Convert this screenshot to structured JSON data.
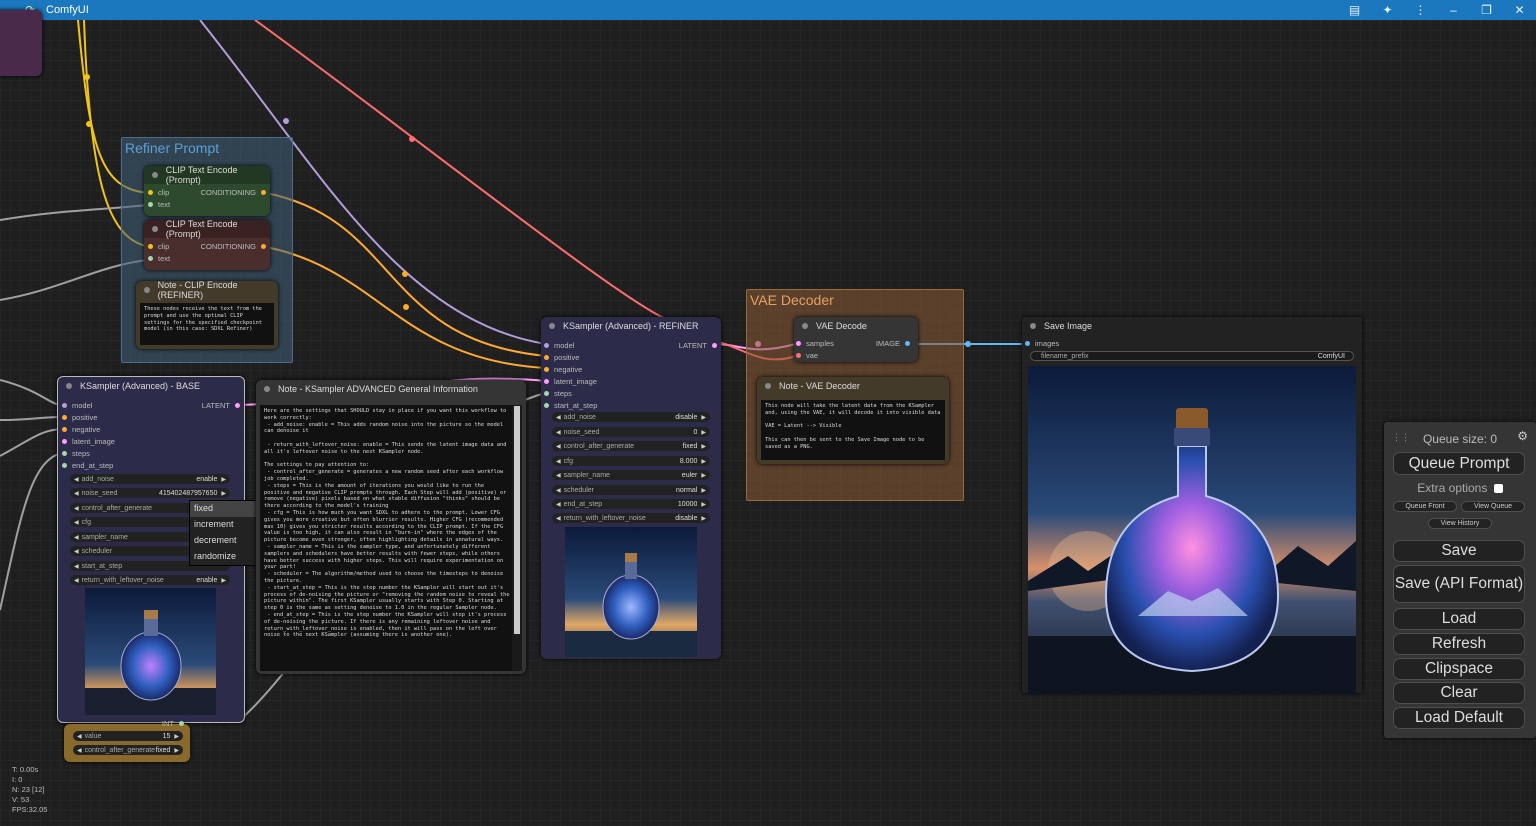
{
  "window": {
    "title": "ComfyUI"
  },
  "colors": {
    "titlebar": "#1c78be",
    "canvas": "#1f1f1f",
    "node_bg": "#353535",
    "green_node": "#2e4a2e",
    "brown_node": "#4a2e2e",
    "vae_group": "#8a5a34",
    "refiner_group": "#3f5f78",
    "clip_wire": "#f0c419",
    "model_wire": "#b39ddb",
    "conditioning_wire": "#ffa931",
    "latent_wire": "#ff9cf9",
    "image_wire": "#64b5f6",
    "vae_wire": "#ff6e6e"
  },
  "groups": {
    "refiner_prompt": {
      "title": "Refiner Prompt"
    },
    "vae_decoder": {
      "title": "VAE Decoder"
    }
  },
  "clip_pos": {
    "title": "CLIP Text Encode (Prompt)",
    "in_clip": "clip",
    "in_text": "text",
    "out": "CONDITIONING"
  },
  "clip_neg": {
    "title": "CLIP Text Encode (Prompt)",
    "in_clip": "clip",
    "in_text": "text",
    "out": "CONDITIONING"
  },
  "note_clip": {
    "title": "Note - CLIP Encode (REFINER)",
    "text": "These nodes receive the text from the prompt and use the optimal CLIP settings for the specified checkpoint model (in this case: SDXL Refiner)"
  },
  "ksampler_base": {
    "title": "KSampler (Advanced) - BASE",
    "inputs": [
      "model",
      "positive",
      "negative",
      "latent_image",
      "steps",
      "end_at_step"
    ],
    "output": "LATENT",
    "widgets": [
      {
        "label": "add_noise",
        "value": "enable"
      },
      {
        "label": "noise_seed",
        "value": "415402487957650"
      },
      {
        "label": "control_after_generate",
        "value": ""
      },
      {
        "label": "cfg",
        "value": ""
      },
      {
        "label": "sampler_name",
        "value": ""
      },
      {
        "label": "scheduler",
        "value": ""
      },
      {
        "label": "start_at_step",
        "value": ""
      },
      {
        "label": "return_with_leftover_noise",
        "value": "enable"
      }
    ]
  },
  "dropdown": {
    "options": [
      "fixed",
      "increment",
      "decrement",
      "randomize"
    ],
    "selected": "fixed"
  },
  "primitive": {
    "out_label": "INT",
    "widgets": [
      {
        "label": "value",
        "value": "15"
      },
      {
        "label": "control_after_generate",
        "value": "fixed"
      }
    ]
  },
  "note_ksampler": {
    "title": "Note - KSampler  ADVANCED General Information",
    "text": "Here are the settings that SHOULD stay in place if you want this workflow to work correctly:\n - add_noise: enable = This adds random noise into the picture so the model can denoise it\n\n - return_with_leftover_noise: enable = This sends the latent image data and all it's leftover noise to the next KSampler node.\n\nThe settings to pay attention to:\n - control_after_generate = generates a new random seed after each workflow job completed.\n - steps = This is the amount of iterations you would like to run the positive and negative CLIP prompts through. Each Step will add (positive) or remove (negative) pixels based on what stable diffusion \"thinks\" should be there according to the model's training\n - cfg = This is how much you want SDXL to adhere to the prompt. Lower CFG gives you more creative but often blurrier results. Higher CFG (recommended max 10) gives you stricter results according to the CLIP prompt. If the CFG value is too high, it can also result in \"burn-in\" where the edges of the picture become even stronger, often highlighting details in unnatural ways.\n - sampler_name = This is the sampler type, and unfortunately different samplers and schedulers have better results with fewer steps, while others have better success with higher steps. This will require experimentation on your part!\n - scheduler = The algorithm/method used to choose the timesteps to denoise the picture.\n - start_at_step = This is the step number the KSampler will start out it's process of de-noising the picture or \"removing the random noise to reveal the picture within\". The first KSampler usually starts with Step 0. Starting at step 0 is the same as setting denoise to 1.0 in the regular Sampler node.\n - end_at_step = This is the step number the KSampler will stop it's process of de-noising the picture. If there is any remaining leftover noise and return_with_leftover_noise is enabled, then it will pass on the left over noise to the next KSampler (assuming there is another one)."
  },
  "ksampler_refiner": {
    "title": "KSampler (Advanced) - REFINER",
    "inputs": [
      "model",
      "positive",
      "negative",
      "latent_image",
      "steps",
      "start_at_step"
    ],
    "output": "LATENT",
    "widgets": [
      {
        "label": "add_noise",
        "value": "disable"
      },
      {
        "label": "noise_seed",
        "value": "0"
      },
      {
        "label": "control_after_generate",
        "value": "fixed"
      },
      {
        "label": "cfg",
        "value": "8.000"
      },
      {
        "label": "sampler_name",
        "value": "euler"
      },
      {
        "label": "scheduler",
        "value": "normal"
      },
      {
        "label": "end_at_step",
        "value": "10000"
      },
      {
        "label": "return_with_leftover_noise",
        "value": "disable"
      }
    ]
  },
  "vae_decode": {
    "title": "VAE Decode",
    "in_samples": "samples",
    "in_vae": "vae",
    "out": "IMAGE"
  },
  "note_vae": {
    "title": "Note - VAE Decoder",
    "text": "This node will take the latent data from the KSampler and, using the VAE, it will decode it into visible data\n\nVAE = Latent --> Visible\n\nThis can then be sent to the Save Image node to be saved as a PNG."
  },
  "save_image": {
    "title": "Save Image",
    "in_images": "images",
    "prefix_label": "filename_prefix",
    "prefix_value": "ComfyUI"
  },
  "queue_panel": {
    "queue_size": "Queue size: 0",
    "queue_prompt": "Queue Prompt",
    "extra_options": "Extra options",
    "queue_front": "Queue Front",
    "view_queue": "View Queue",
    "view_history": "View History",
    "save": "Save",
    "save_api": "Save (API Format)",
    "load": "Load",
    "refresh": "Refresh",
    "clipspace": "Clipspace",
    "clear": "Clear",
    "load_default": "Load Default"
  },
  "stats": {
    "t": "T: 0.00s",
    "i": "I: 0",
    "n": "N: 23 [12]",
    "v": "V: 53",
    "fps": "FPS:32.05"
  }
}
